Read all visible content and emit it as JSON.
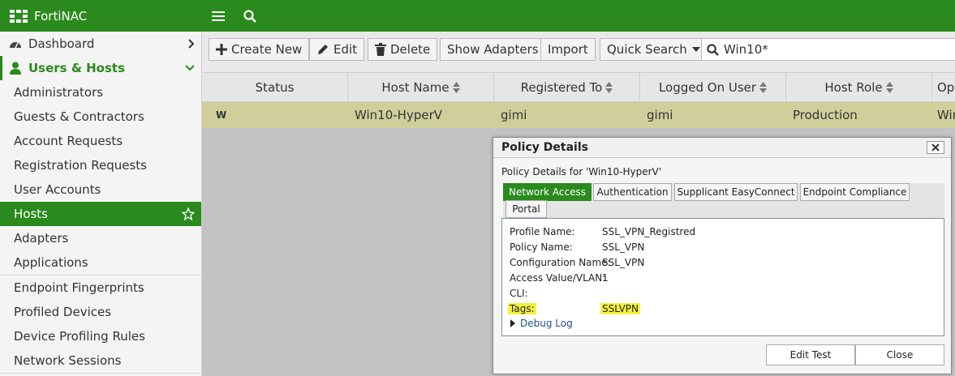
{
  "app": {
    "title": "FortiNAC"
  },
  "sidebar": {
    "items": [
      {
        "label": "Dashboard",
        "type": "top"
      },
      {
        "label": "Users & Hosts",
        "type": "section"
      },
      {
        "label": "Administrators"
      },
      {
        "label": "Guests & Contractors"
      },
      {
        "label": "Account Requests"
      },
      {
        "label": "Registration Requests"
      },
      {
        "label": "User Accounts"
      },
      {
        "label": "Hosts",
        "active": true
      },
      {
        "label": "Adapters"
      },
      {
        "label": "Applications"
      },
      {
        "label": "Endpoint Fingerprints"
      },
      {
        "label": "Profiled Devices"
      },
      {
        "label": "Device Profiling Rules"
      },
      {
        "label": "Network Sessions"
      }
    ]
  },
  "toolbar": {
    "create_new": "Create New",
    "edit": "Edit",
    "delete": "Delete",
    "show_adapters": "Show Adapters",
    "import": "Import",
    "quick_search": "Quick Search",
    "search_value": "Win10*"
  },
  "table": {
    "columns": [
      "Status",
      "Host Name",
      "Registered To",
      "Logged On User",
      "Host Role",
      "Op"
    ],
    "rows": [
      {
        "status": "W",
        "host_name": "Win10-HyperV",
        "registered_to": "gimi",
        "logged_on_user": "gimi",
        "host_role": "Production",
        "op": "Win"
      }
    ]
  },
  "modal": {
    "title": "Policy Details",
    "subtitle": "Policy Details for 'Win10-HyperV'",
    "tabs": [
      "Network Access",
      "Authentication",
      "Supplicant EasyConnect",
      "Endpoint Compliance",
      "Portal"
    ],
    "fields": [
      {
        "label": "Profile Name:",
        "value": "SSL_VPN_Registred"
      },
      {
        "label": "Policy Name:",
        "value": "SSL_VPN"
      },
      {
        "label": "Configuration Name:",
        "value": "SSL_VPN"
      },
      {
        "label": "Access Value/VLAN:",
        "value": "1"
      },
      {
        "label": "CLI:",
        "value": ""
      },
      {
        "label": "Tags:",
        "value": "SSLVPN"
      }
    ],
    "debug_log": "Debug Log",
    "edit_test": "Edit Test",
    "close": "Close"
  },
  "colors": {
    "brand_green": "#2a8a1d",
    "row_highlight": "#cfcf9c",
    "tag_highlight": "#f4f33a",
    "link_blue": "#1f4e8c"
  }
}
